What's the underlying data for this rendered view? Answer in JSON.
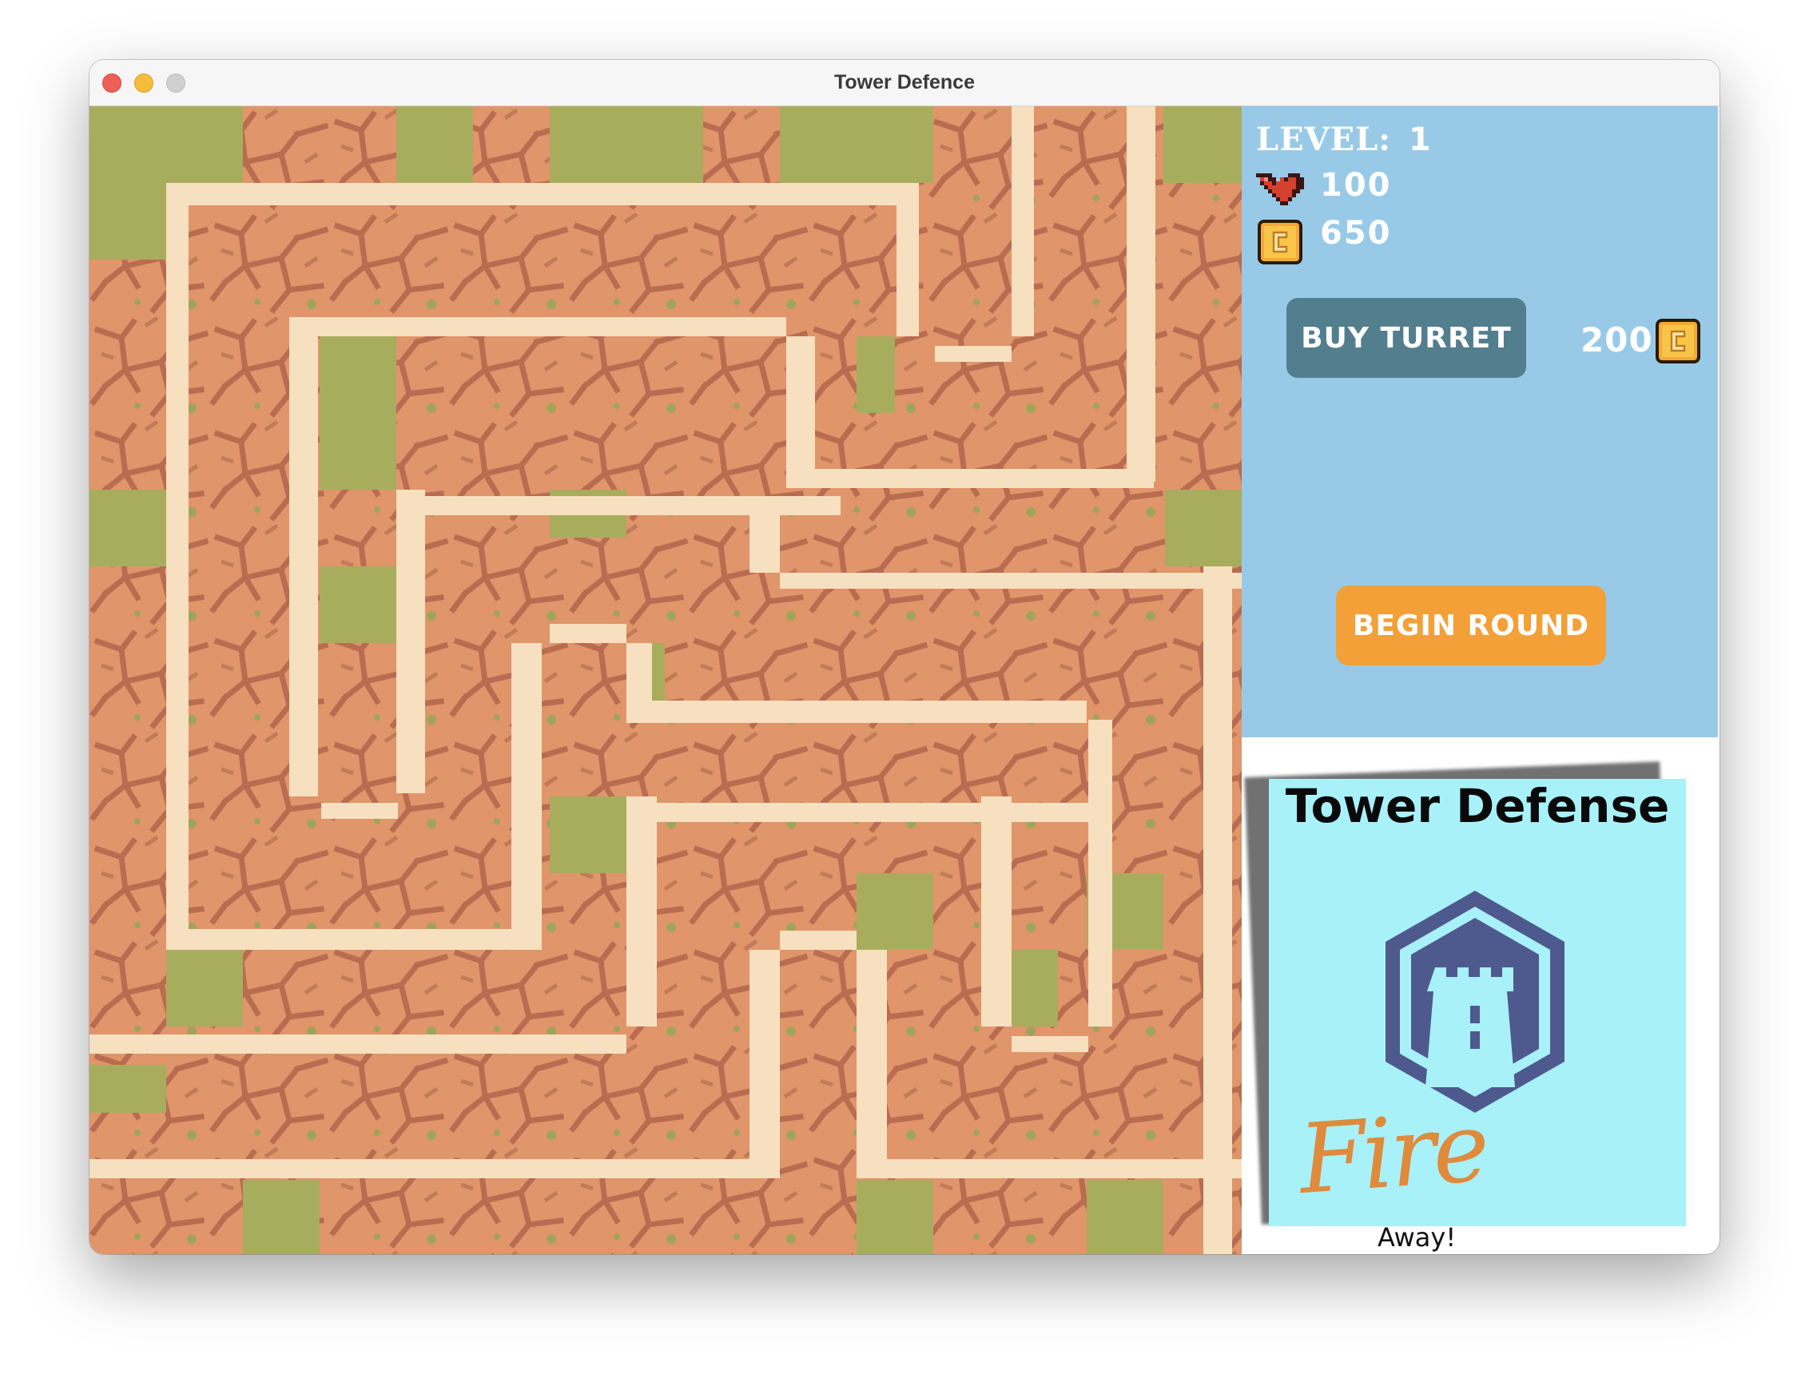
{
  "window": {
    "title": "Tower Defence"
  },
  "hud": {
    "level_label": "LEVEL:",
    "level_value": "1",
    "health": "100",
    "money": "650",
    "buy_turret_label": "BUY TURRET",
    "turret_price": "200",
    "begin_round_label": "BEGIN ROUND"
  },
  "poster": {
    "title": "Tower Defense",
    "fire": "Fire",
    "away": "Away!"
  },
  "colors": {
    "sidebar_bg": "#98cae8",
    "buy_button": "#527e8e",
    "begin_button": "#f2a037",
    "path": "#f6e0bf",
    "ground": "#e0956a",
    "grass": "#a8ad5d",
    "crack": "#b86a4e",
    "poster_bg": "#a8f1f9",
    "tower_badge": "#4e5a8e"
  },
  "icons": [
    "heart-icon",
    "coin-icon",
    "tower-badge-icon"
  ]
}
